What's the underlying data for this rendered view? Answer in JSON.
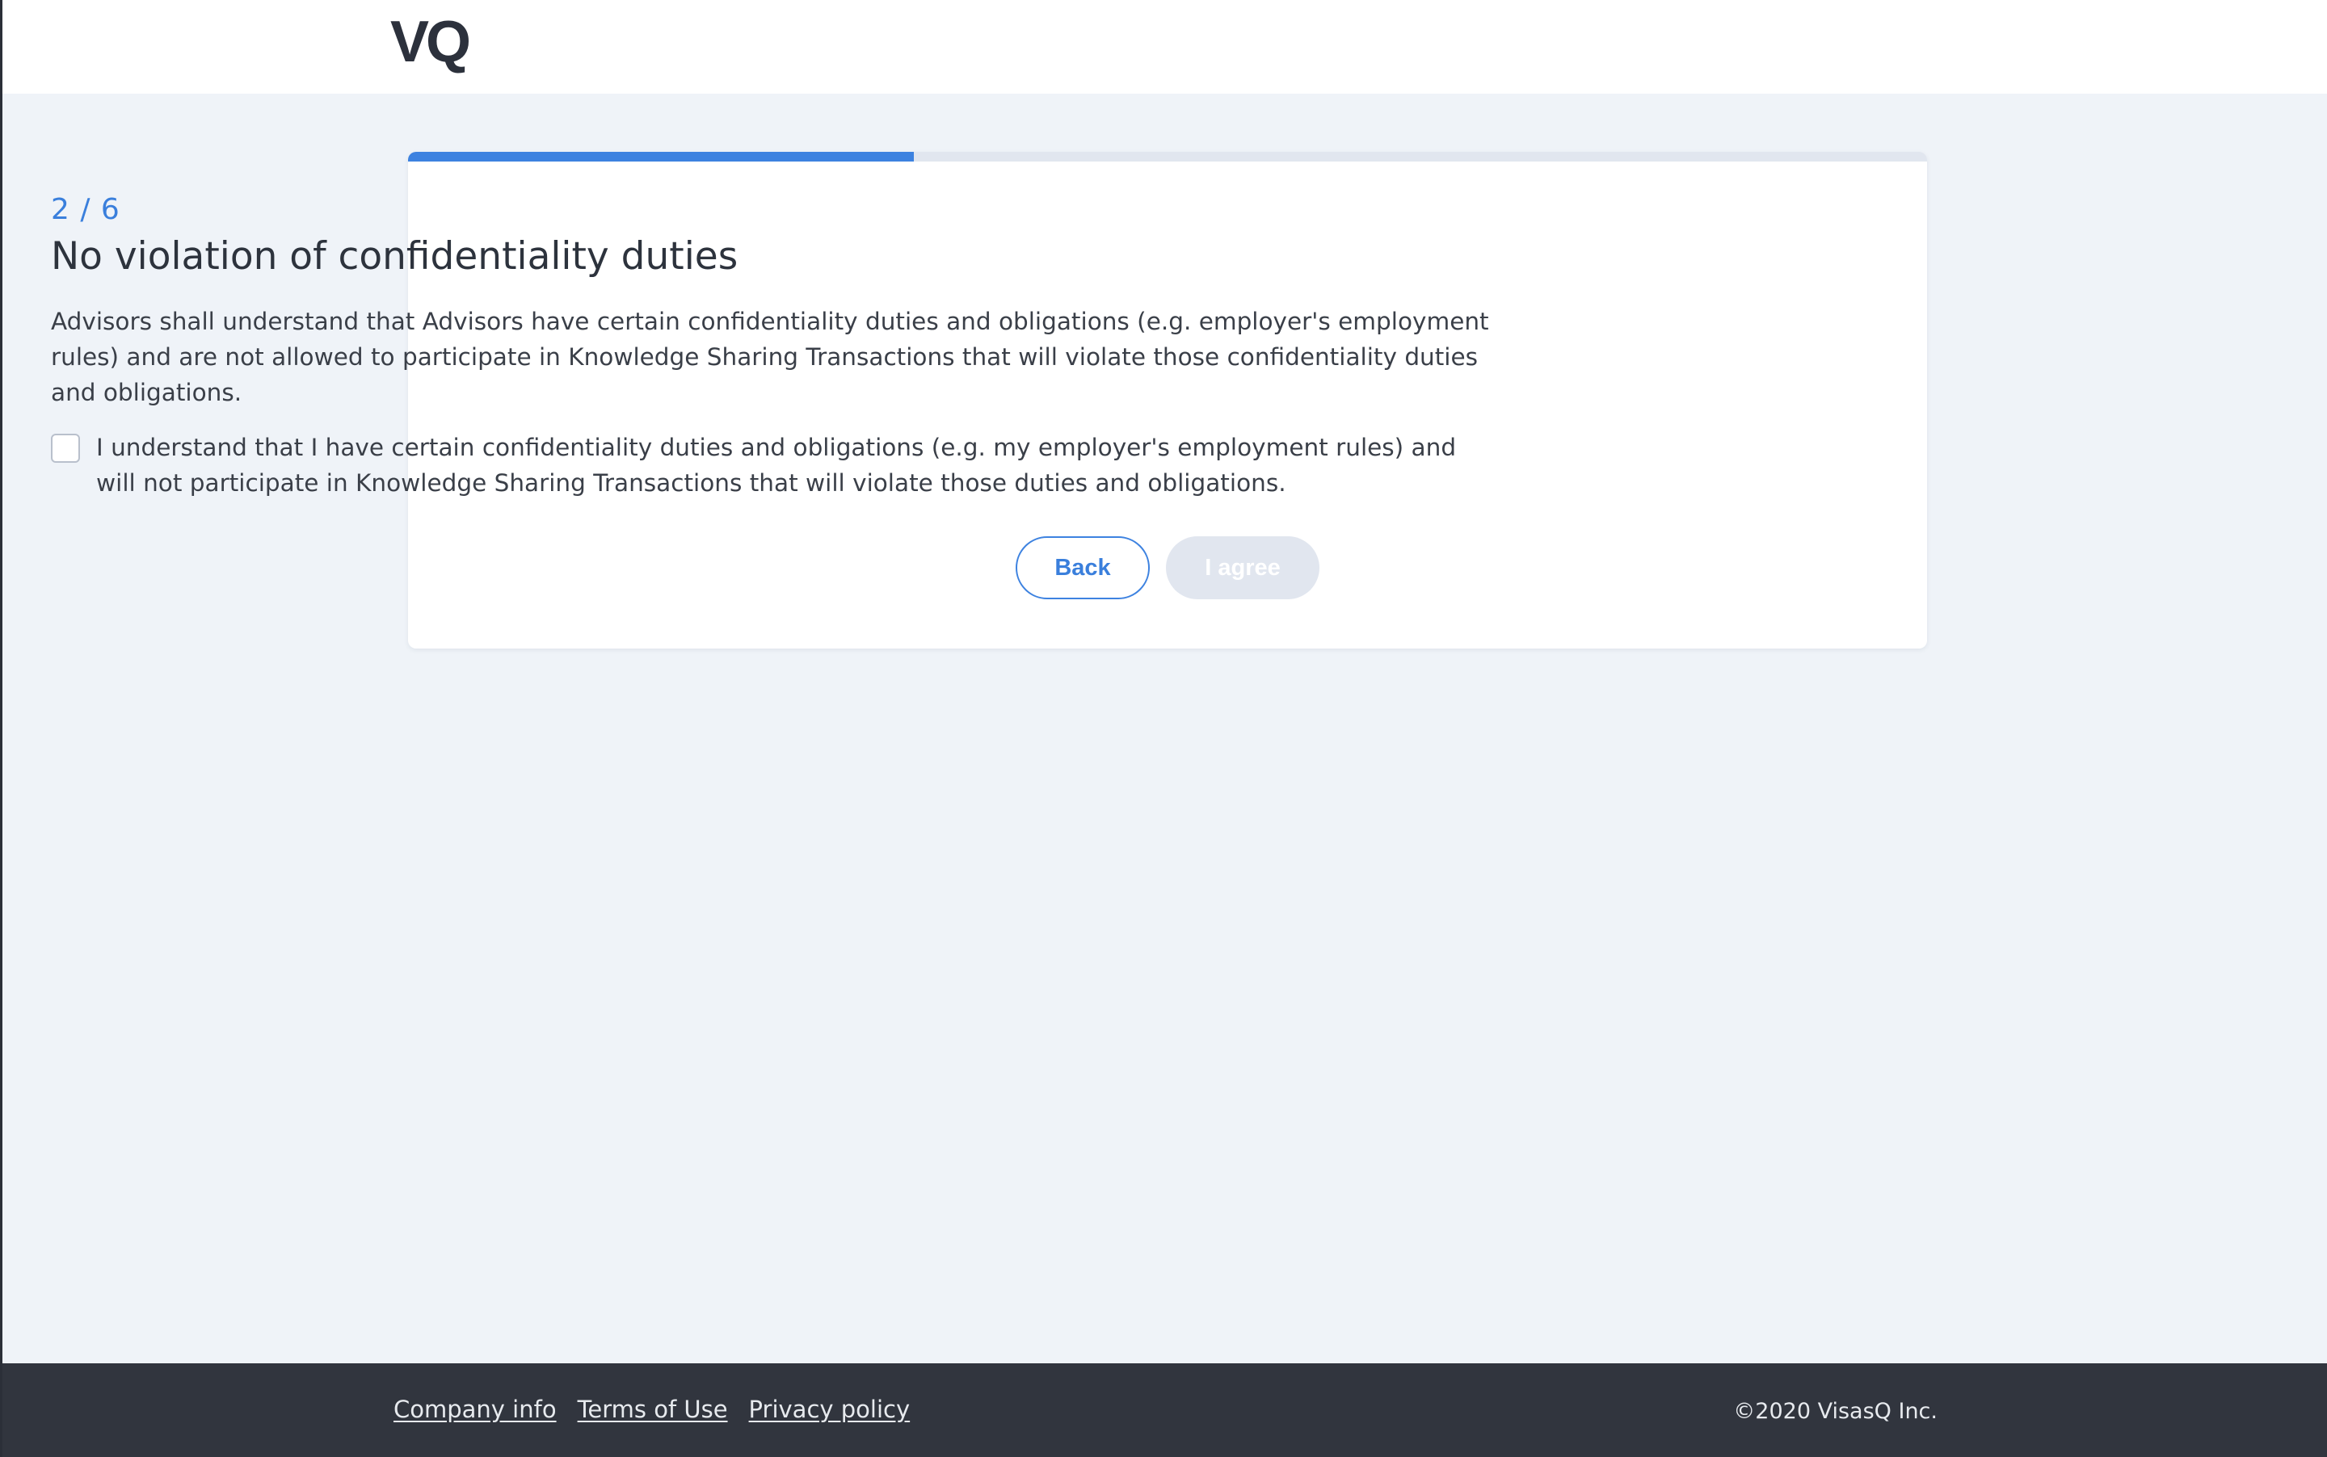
{
  "header": {
    "logo_text": "VQ"
  },
  "progress": {
    "current_step": 2,
    "total_steps": 6,
    "fill_fraction": 0.333,
    "counter_text": "2 / 6"
  },
  "content": {
    "title": "No violation of confidentiality duties",
    "description": "Advisors shall understand that Advisors have certain confidentiality duties and obligations (e.g. employer's employment rules) and are not allowed to participate in Knowledge Sharing Transactions that will violate those confidentiality duties and obligations.",
    "checkbox_label": "I understand that I have certain confidentiality duties and obligations (e.g. my employer's employment rules) and will not participate in Knowledge Sharing Transactions that will violate those duties and obligations.",
    "checkbox_checked": false
  },
  "actions": {
    "back_label": "Back",
    "agree_label": "I agree",
    "agree_disabled": true
  },
  "footer": {
    "links": [
      {
        "label": "Company info"
      },
      {
        "label": "Terms of Use"
      },
      {
        "label": "Privacy policy"
      }
    ],
    "copyright": "©2020 VisasQ Inc."
  },
  "colors": {
    "accent": "#3d82e0",
    "page_background": "#eff3f8",
    "footer_background": "#31353e",
    "disabled_button": "#e1e6ef"
  }
}
